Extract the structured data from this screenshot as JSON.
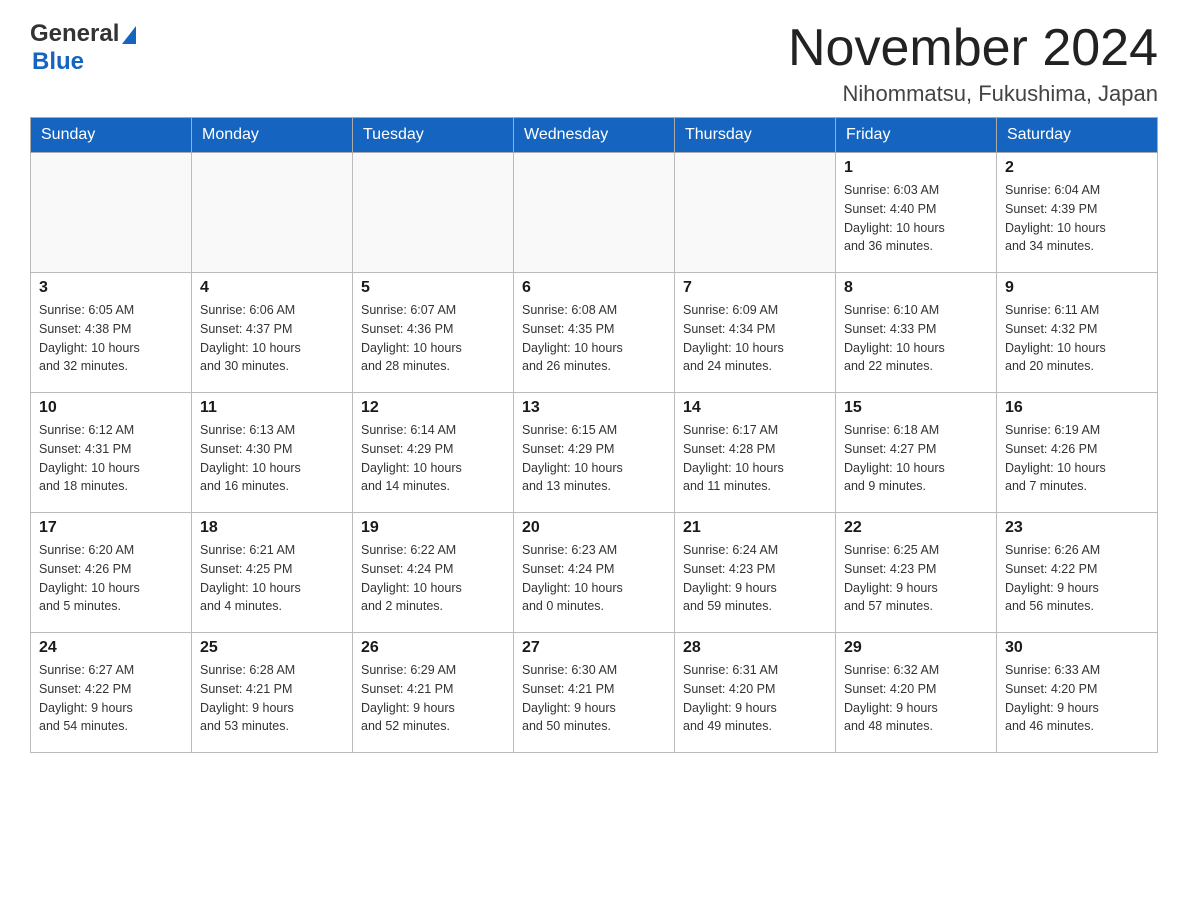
{
  "header": {
    "logo": {
      "general": "General",
      "blue": "Blue"
    },
    "title": "November 2024",
    "location": "Nihommatsu, Fukushima, Japan"
  },
  "calendar": {
    "weekdays": [
      "Sunday",
      "Monday",
      "Tuesday",
      "Wednesday",
      "Thursday",
      "Friday",
      "Saturday"
    ],
    "weeks": [
      [
        {
          "day": "",
          "info": ""
        },
        {
          "day": "",
          "info": ""
        },
        {
          "day": "",
          "info": ""
        },
        {
          "day": "",
          "info": ""
        },
        {
          "day": "",
          "info": ""
        },
        {
          "day": "1",
          "info": "Sunrise: 6:03 AM\nSunset: 4:40 PM\nDaylight: 10 hours\nand 36 minutes."
        },
        {
          "day": "2",
          "info": "Sunrise: 6:04 AM\nSunset: 4:39 PM\nDaylight: 10 hours\nand 34 minutes."
        }
      ],
      [
        {
          "day": "3",
          "info": "Sunrise: 6:05 AM\nSunset: 4:38 PM\nDaylight: 10 hours\nand 32 minutes."
        },
        {
          "day": "4",
          "info": "Sunrise: 6:06 AM\nSunset: 4:37 PM\nDaylight: 10 hours\nand 30 minutes."
        },
        {
          "day": "5",
          "info": "Sunrise: 6:07 AM\nSunset: 4:36 PM\nDaylight: 10 hours\nand 28 minutes."
        },
        {
          "day": "6",
          "info": "Sunrise: 6:08 AM\nSunset: 4:35 PM\nDaylight: 10 hours\nand 26 minutes."
        },
        {
          "day": "7",
          "info": "Sunrise: 6:09 AM\nSunset: 4:34 PM\nDaylight: 10 hours\nand 24 minutes."
        },
        {
          "day": "8",
          "info": "Sunrise: 6:10 AM\nSunset: 4:33 PM\nDaylight: 10 hours\nand 22 minutes."
        },
        {
          "day": "9",
          "info": "Sunrise: 6:11 AM\nSunset: 4:32 PM\nDaylight: 10 hours\nand 20 minutes."
        }
      ],
      [
        {
          "day": "10",
          "info": "Sunrise: 6:12 AM\nSunset: 4:31 PM\nDaylight: 10 hours\nand 18 minutes."
        },
        {
          "day": "11",
          "info": "Sunrise: 6:13 AM\nSunset: 4:30 PM\nDaylight: 10 hours\nand 16 minutes."
        },
        {
          "day": "12",
          "info": "Sunrise: 6:14 AM\nSunset: 4:29 PM\nDaylight: 10 hours\nand 14 minutes."
        },
        {
          "day": "13",
          "info": "Sunrise: 6:15 AM\nSunset: 4:29 PM\nDaylight: 10 hours\nand 13 minutes."
        },
        {
          "day": "14",
          "info": "Sunrise: 6:17 AM\nSunset: 4:28 PM\nDaylight: 10 hours\nand 11 minutes."
        },
        {
          "day": "15",
          "info": "Sunrise: 6:18 AM\nSunset: 4:27 PM\nDaylight: 10 hours\nand 9 minutes."
        },
        {
          "day": "16",
          "info": "Sunrise: 6:19 AM\nSunset: 4:26 PM\nDaylight: 10 hours\nand 7 minutes."
        }
      ],
      [
        {
          "day": "17",
          "info": "Sunrise: 6:20 AM\nSunset: 4:26 PM\nDaylight: 10 hours\nand 5 minutes."
        },
        {
          "day": "18",
          "info": "Sunrise: 6:21 AM\nSunset: 4:25 PM\nDaylight: 10 hours\nand 4 minutes."
        },
        {
          "day": "19",
          "info": "Sunrise: 6:22 AM\nSunset: 4:24 PM\nDaylight: 10 hours\nand 2 minutes."
        },
        {
          "day": "20",
          "info": "Sunrise: 6:23 AM\nSunset: 4:24 PM\nDaylight: 10 hours\nand 0 minutes."
        },
        {
          "day": "21",
          "info": "Sunrise: 6:24 AM\nSunset: 4:23 PM\nDaylight: 9 hours\nand 59 minutes."
        },
        {
          "day": "22",
          "info": "Sunrise: 6:25 AM\nSunset: 4:23 PM\nDaylight: 9 hours\nand 57 minutes."
        },
        {
          "day": "23",
          "info": "Sunrise: 6:26 AM\nSunset: 4:22 PM\nDaylight: 9 hours\nand 56 minutes."
        }
      ],
      [
        {
          "day": "24",
          "info": "Sunrise: 6:27 AM\nSunset: 4:22 PM\nDaylight: 9 hours\nand 54 minutes."
        },
        {
          "day": "25",
          "info": "Sunrise: 6:28 AM\nSunset: 4:21 PM\nDaylight: 9 hours\nand 53 minutes."
        },
        {
          "day": "26",
          "info": "Sunrise: 6:29 AM\nSunset: 4:21 PM\nDaylight: 9 hours\nand 52 minutes."
        },
        {
          "day": "27",
          "info": "Sunrise: 6:30 AM\nSunset: 4:21 PM\nDaylight: 9 hours\nand 50 minutes."
        },
        {
          "day": "28",
          "info": "Sunrise: 6:31 AM\nSunset: 4:20 PM\nDaylight: 9 hours\nand 49 minutes."
        },
        {
          "day": "29",
          "info": "Sunrise: 6:32 AM\nSunset: 4:20 PM\nDaylight: 9 hours\nand 48 minutes."
        },
        {
          "day": "30",
          "info": "Sunrise: 6:33 AM\nSunset: 4:20 PM\nDaylight: 9 hours\nand 46 minutes."
        }
      ]
    ]
  }
}
